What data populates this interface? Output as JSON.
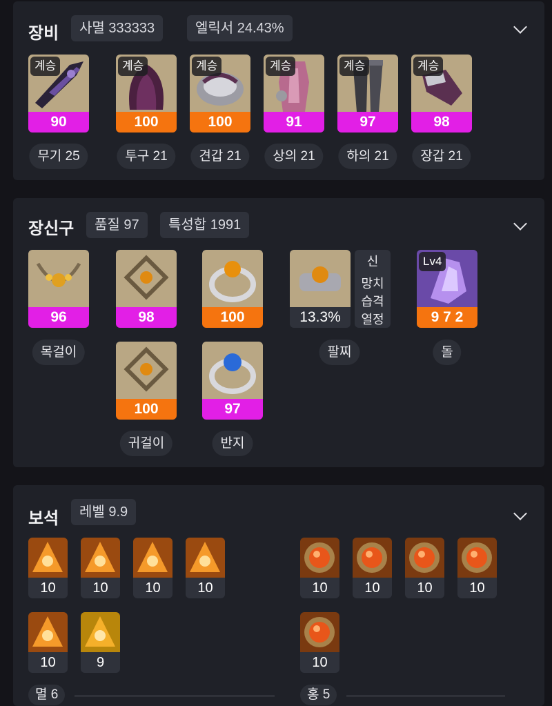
{
  "equipment": {
    "title": "장비",
    "chips": [
      "사멸 333333",
      "엘릭서 24.43%"
    ],
    "badge": "계승",
    "items": [
      {
        "quality": "90",
        "label": "무기 25",
        "quality_color": "#e21fe6",
        "icon": "weapon-icon"
      },
      {
        "quality": "100",
        "label": "투구 21",
        "quality_color": "#f5740f",
        "icon": "helmet-icon"
      },
      {
        "quality": "100",
        "label": "견갑 21",
        "quality_color": "#f5740f",
        "icon": "shoulder-icon"
      },
      {
        "quality": "91",
        "label": "상의 21",
        "quality_color": "#e21fe6",
        "icon": "chest-armor-icon"
      },
      {
        "quality": "97",
        "label": "하의 21",
        "quality_color": "#e21fe6",
        "icon": "pants-icon"
      },
      {
        "quality": "98",
        "label": "장갑 21",
        "quality_color": "#e21fe6",
        "icon": "gloves-icon"
      }
    ]
  },
  "accessories": {
    "title": "장신구",
    "chips": [
      "품질 97",
      "특성합 1991"
    ],
    "items": [
      {
        "quality": "96",
        "label": "목걸이",
        "icon": "necklace-icon"
      },
      {
        "quality": "98",
        "icon": "earring-icon"
      },
      {
        "quality": "100",
        "icon": "ring-icon"
      },
      {
        "quality": "100",
        "label": "귀걸이",
        "icon": "earring-icon"
      },
      {
        "quality": "97",
        "label": "반지",
        "icon": "ring-icon"
      }
    ],
    "bracelet": {
      "value": "13.3%",
      "label": "팔찌",
      "effects": [
        "신",
        "망치",
        "습격",
        "열정"
      ],
      "icon": "bracelet-icon"
    },
    "stone": {
      "badge": "Lv4",
      "value": "9 7 2",
      "label": "돌",
      "icon": "ability-stone-icon"
    }
  },
  "gems": {
    "title": "보석",
    "chips": [
      "레벨 9.9"
    ],
    "left_levels": [
      "10",
      "10",
      "10",
      "10",
      "10",
      "9"
    ],
    "right_levels": [
      "10",
      "10",
      "10",
      "10",
      "10"
    ],
    "left_group_label": "멸 6",
    "right_group_label": "홍 5",
    "left_icon": "annihilation-gem-icon",
    "right_icon": "crimson-gem-icon"
  },
  "colors": {
    "magenta_quality": "#e21fe6",
    "orange_quality": "#f5740f",
    "card_bg": "#1f2128",
    "page_bg": "#141419"
  }
}
